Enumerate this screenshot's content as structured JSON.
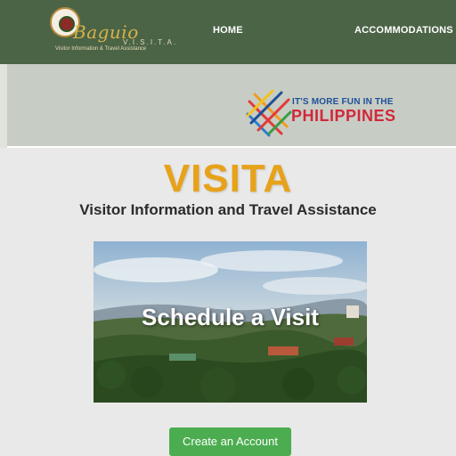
{
  "header": {
    "logo": {
      "script_text": "Baguio",
      "brand": "V.I.S.I.T.A.",
      "tagline": "Visitor Information & Travel Assistance"
    },
    "nav": [
      {
        "label": "HOME"
      },
      {
        "label": "ACCOMMODATIONS"
      }
    ],
    "background": "#4b6446"
  },
  "banner": {
    "fun_logo": {
      "line1": "IT'S MORE FUN IN THE",
      "line2": "PHILIPPINES"
    },
    "background": "#c7cdc4"
  },
  "main": {
    "title": "VISITA",
    "subtitle": "Visitor Information and Travel Assistance",
    "hero": {
      "caption": "Schedule a Visit"
    },
    "cta": {
      "label": "Create an Account",
      "color": "#4bad4f"
    },
    "title_color": "#e7a21a"
  }
}
